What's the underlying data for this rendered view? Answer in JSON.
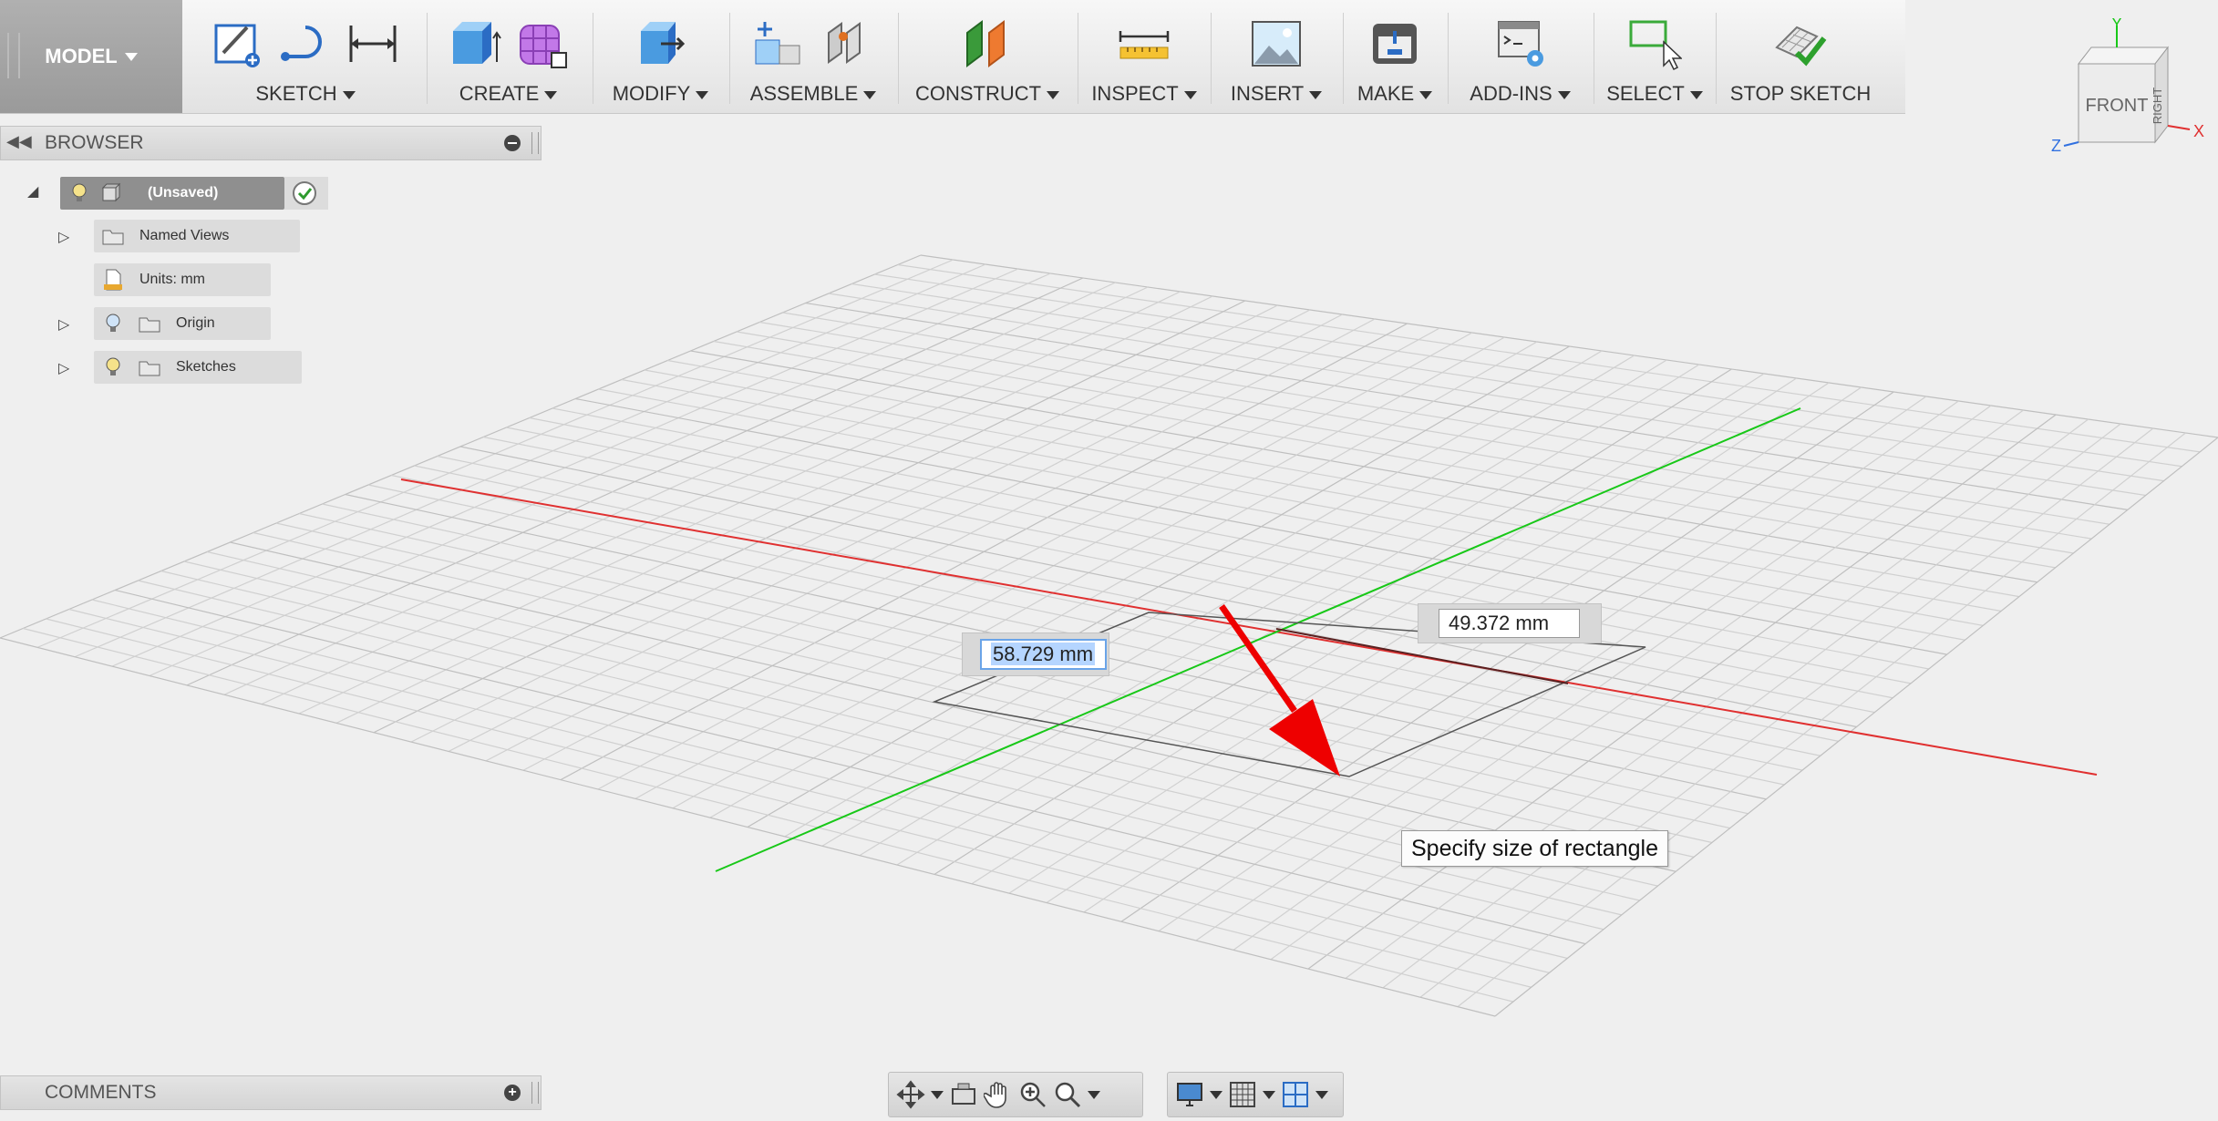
{
  "toolbar": {
    "workspace": "MODEL",
    "groups": [
      {
        "label": "SKETCH"
      },
      {
        "label": "CREATE"
      },
      {
        "label": "MODIFY"
      },
      {
        "label": "ASSEMBLE"
      },
      {
        "label": "CONSTRUCT"
      },
      {
        "label": "INSPECT"
      },
      {
        "label": "INSERT"
      },
      {
        "label": "MAKE"
      },
      {
        "label": "ADD-INS"
      },
      {
        "label": "SELECT"
      }
    ],
    "stop_sketch": "STOP SKETCH"
  },
  "browser": {
    "title": "BROWSER",
    "root": "(Unsaved)",
    "items": [
      {
        "label": "Named Views",
        "icon": "folder-icon"
      },
      {
        "label": "Units: mm",
        "icon": "document-icon"
      },
      {
        "label": "Origin",
        "icon": "folder-icon"
      },
      {
        "label": "Sketches",
        "icon": "folder-icon"
      }
    ]
  },
  "comments": {
    "title": "COMMENTS"
  },
  "canvas": {
    "width_dimension": "58.729 mm",
    "height_dimension": "49.372 mm",
    "tooltip": "Specify size of rectangle",
    "axis_colors": {
      "x": "#e03030",
      "y": "#18c818"
    },
    "annotation_color": "#ee0000"
  },
  "viewcube": {
    "front": "FRONT",
    "right": "RIGHT",
    "axis_x": "X",
    "axis_y": "Y",
    "axis_z": "Z"
  }
}
